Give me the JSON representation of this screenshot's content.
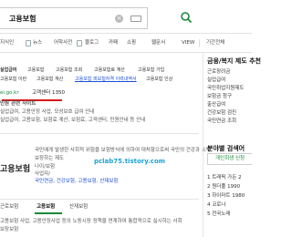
{
  "search": {
    "query": "고용보험"
  },
  "tabs": [
    "지식인",
    "뉴스",
    "어학사전",
    "블로그",
    "카페",
    "쇼핑",
    "웹문서",
    "VIEW",
    "지식iN",
    "기간전체"
  ],
  "related_prefix": "실업급여",
  "related": [
    "고용보험",
    "고용보험 조회",
    "고용보험료 계산",
    "고용보험 가입"
  ],
  "related2": [
    "고용보험 이란",
    "고용보험 계산",
    "고용보험 피보험자격 이력내역서",
    "고용보험 인상"
  ],
  "result1": {
    "url": "ei.go.kr",
    "tel": "고객센터 1350",
    "title": "민원 관련 사이트",
    "desc": "실업급여, 고용안정 사업, 모성보호 급여 안내",
    "links": "실업급여, 고용보험, 보험료 계산, 보험료, 고객센터, 민원안내 등 안내"
  },
  "result2": {
    "heading": "고용보험",
    "desc": "국민에게 발생한 사회적 위험을 보험방식에 의하여 대처함으로써 국민의 건강과 소득",
    "line2": "보장하는 제도",
    "label1": "나이/보험",
    "label2": "사업자/",
    "tags": "국민연금, 건강보험, 고용보험, 산재보험"
  },
  "bottom_tabs": [
    "근로보험",
    "고용보험",
    "산재보험"
  ],
  "bottom_desc1": "고용보험 사업, 고용안정사업 등의 노동시장 정책을 연계하여 통합적으로 실시하는 사회",
  "bottom_desc2": "보장보험",
  "watermark": "pclab75.tistory.com",
  "sidebar": {
    "title": "금융/복지 제도 추천",
    "links": [
      "근로장려금",
      "실업급여",
      "국민취업지원제도",
      "보험금 청구",
      "출산급여",
      "건강보험 검진",
      "국민연금 조회"
    ],
    "popular_title": "분야별 검색어",
    "button": "개인회생 신청",
    "ranks": [
      "1 트래픽 가든 2",
      "2 원더풀 1990",
      "3 하이마트 1980",
      "4 코로나",
      "5 전국노래"
    ]
  },
  "colors": {
    "accent": "#1a8a3a",
    "underline": "#d61a1a",
    "watermark": "#1aa3d6"
  }
}
